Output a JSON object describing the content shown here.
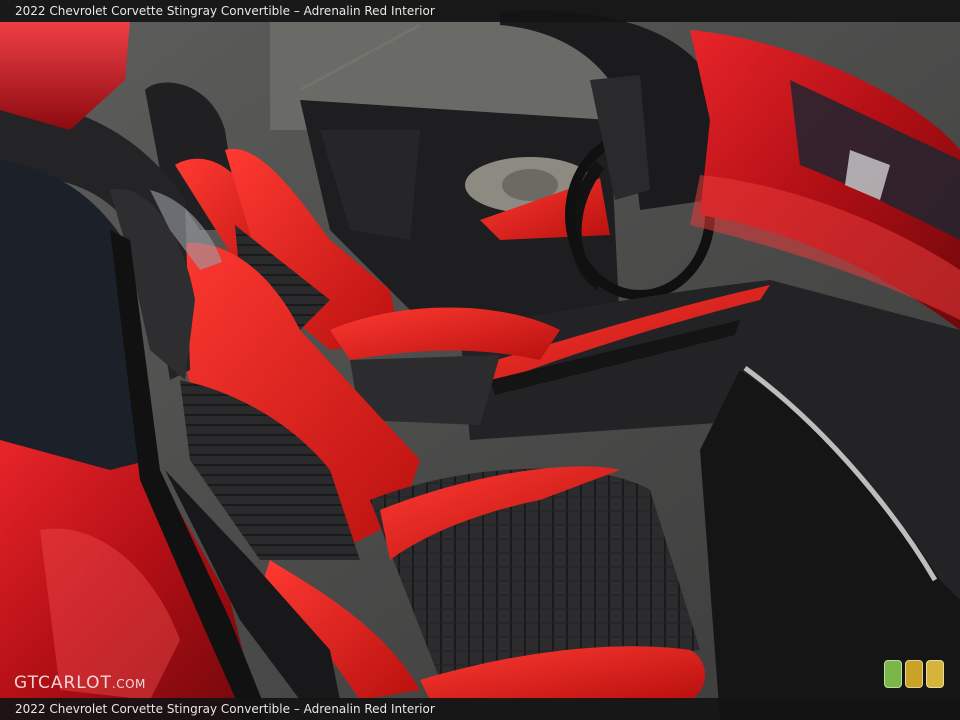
{
  "caption_top": "2022 Chevrolet Corvette Stingray Convertible – Adrenalin Red Interior",
  "caption_bottom": "2022 Chevrolet Corvette Stingray Convertible – Adrenalin Red Interior",
  "watermark": {
    "main": "GTCARLOT",
    "suffix": ".COM"
  },
  "badge_colors": [
    "#7ab648",
    "#c9a227",
    "#d4b43a"
  ],
  "colors": {
    "paint": "#c8141a",
    "leather": "#e01e1e",
    "dark": "#1c1c1e"
  }
}
